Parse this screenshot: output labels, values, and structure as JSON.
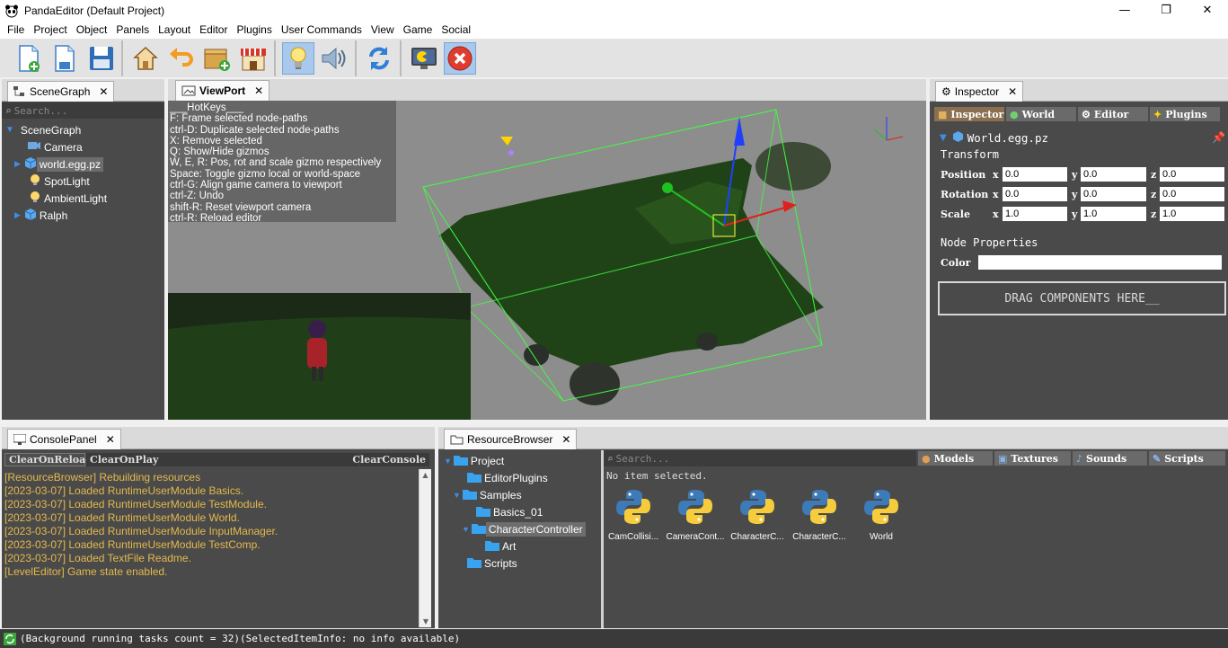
{
  "window": {
    "title": "PandaEditor (Default Project)",
    "minimize": "—",
    "maximize": "❐",
    "close": "✕"
  },
  "menu": [
    "File",
    "Project",
    "Object",
    "Panels",
    "Layout",
    "Editor",
    "Plugins",
    "User Commands",
    "View",
    "Game",
    "Social"
  ],
  "scenegraph": {
    "tab": "SceneGraph",
    "search_placeholder": "Search...",
    "root": "SceneGraph",
    "items": [
      {
        "label": "Camera",
        "icon": "camera-icon"
      },
      {
        "label": "world.egg.pz",
        "icon": "cube-icon",
        "selected": true
      },
      {
        "label": "SpotLight",
        "icon": "bulb-icon"
      },
      {
        "label": "AmbientLight",
        "icon": "bulb-icon"
      },
      {
        "label": "Ralph",
        "icon": "cube-icon"
      }
    ]
  },
  "viewport": {
    "tab": "ViewPort",
    "hotkeys": [
      "___HotKeys___",
      "F: Frame selected node-paths",
      "ctrl-D: Duplicate selected node-paths",
      "X: Remove selected",
      "Q: Show/Hide gizmos",
      "W, E, R: Pos, rot and scale gizmo respectively",
      "Space: Toggle gizmo local or world-space",
      "ctrl-G: Align game camera to viewport",
      "ctrl-Z: Undo",
      "shift-R: Reset viewport camera",
      "ctrl-R: Reload editor"
    ]
  },
  "inspector": {
    "tab": "Inspector",
    "subtabs": [
      "Inspector",
      "World",
      "Editor",
      "Plugins"
    ],
    "object_name": "World.egg.pz",
    "transform_label": "Transform",
    "rows": [
      {
        "label": "Position",
        "x": "0.0",
        "y": "0.0",
        "z": "0.0"
      },
      {
        "label": "Rotation",
        "x": "0.0",
        "y": "0.0",
        "z": "0.0"
      },
      {
        "label": "Scale",
        "x": "1.0",
        "y": "1.0",
        "z": "1.0"
      }
    ],
    "axis_x": "x",
    "axis_y": "y",
    "axis_z": "z",
    "node_properties": "Node Properties",
    "color_label": "Color",
    "drag_text": "DRAG COMPONENTS HERE__"
  },
  "console": {
    "tab": "ConsolePanel",
    "btn_clear_on_reload": "ClearOnReload",
    "btn_clear_on_play": "ClearOnPlay",
    "btn_clear_console": "ClearConsole",
    "lines": [
      "[ResourceBrowser] Rebuilding resources",
      "[2023-03-07] Loaded RuntimeUserModule Basics.",
      "[2023-03-07] Loaded RuntimeUserModule TestModule.",
      "[2023-03-07] Loaded RuntimeUserModule World.",
      "[2023-03-07] Loaded RuntimeUserModule InputManager.",
      "[2023-03-07] Loaded RuntimeUserModule TestComp.",
      "[2023-03-07] Loaded TextFile Readme.",
      "[LevelEditor] Game state enabled."
    ]
  },
  "resources": {
    "tab": "ResourceBrowser",
    "tree": [
      "Project",
      "EditorPlugins",
      "Samples",
      "Basics_01",
      "CharacterController",
      "Art",
      "Scripts"
    ],
    "search_placeholder": "Search...",
    "filters": [
      "Models",
      "Textures",
      "Sounds",
      "Scripts"
    ],
    "info": "No item selected.",
    "assets": [
      "CamCollisi...",
      "CameraCont...",
      "CharacterC...",
      "CharacterC...",
      "World"
    ]
  },
  "status": {
    "text": "(Background running tasks count = 32)(SelectedItemInfo: no info available)"
  },
  "colors": {
    "panel_bg": "#4a4a4a",
    "log_text": "#e5b94d",
    "accent_blue": "#1e6fd9"
  }
}
